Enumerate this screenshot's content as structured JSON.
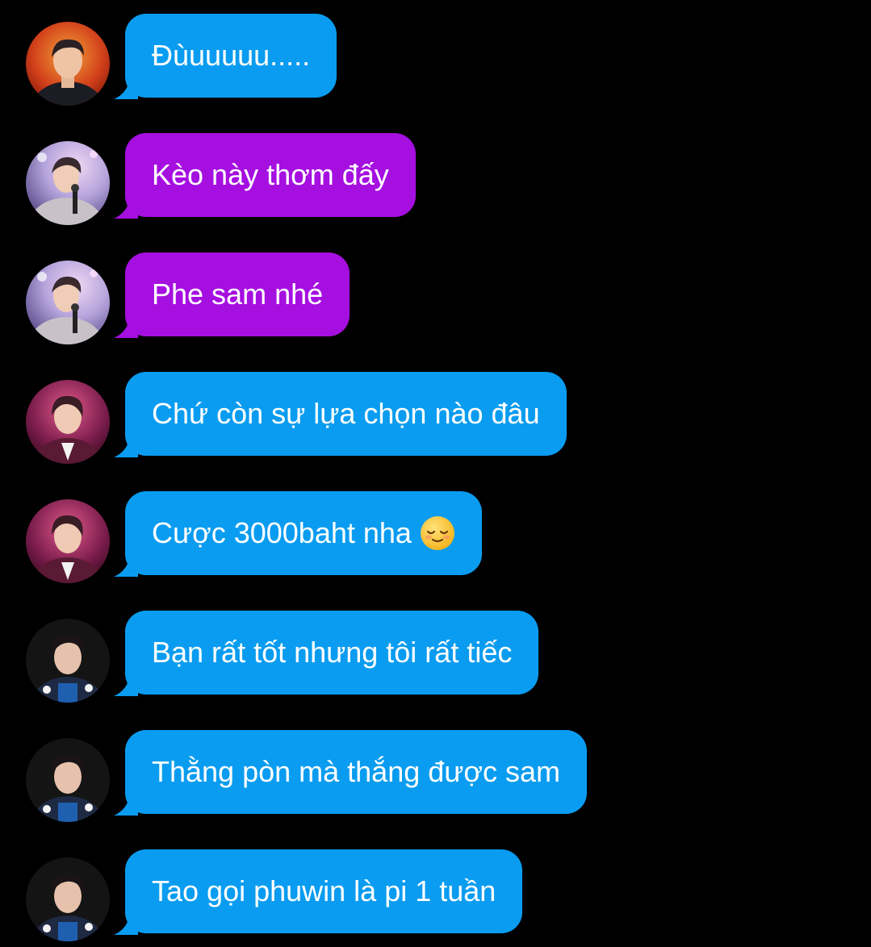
{
  "colors": {
    "background": "#000000",
    "bubble_blue": "#0a9cf0",
    "bubble_purple": "#a50fe0",
    "text": "#ffffff"
  },
  "messages": [
    {
      "text": "Đùuuuuu.....",
      "bubble_color": "blue",
      "avatar": "avatar-red-stage"
    },
    {
      "text": "Kèo này thơm đấy",
      "bubble_color": "purple",
      "avatar": "avatar-mic-lights"
    },
    {
      "text": "Phe sam nhé",
      "bubble_color": "purple",
      "avatar": "avatar-mic-lights"
    },
    {
      "text": "Chứ còn sự lựa chọn nào đâu",
      "bubble_color": "blue",
      "avatar": "avatar-pink-stage"
    },
    {
      "text": "Cược 3000baht nha",
      "bubble_color": "blue",
      "avatar": "avatar-pink-stage",
      "emoji": "relieved-face-emoji"
    },
    {
      "text": "Bạn rất tốt nhưng tôi rất tiếc",
      "bubble_color": "blue",
      "avatar": "avatar-dark-flowers"
    },
    {
      "text": "Thằng pòn mà thắng được sam",
      "bubble_color": "blue",
      "avatar": "avatar-dark-flowers"
    },
    {
      "text": "Tao gọi phuwin là pi 1 tuần",
      "bubble_color": "blue",
      "avatar": "avatar-dark-flowers"
    }
  ]
}
